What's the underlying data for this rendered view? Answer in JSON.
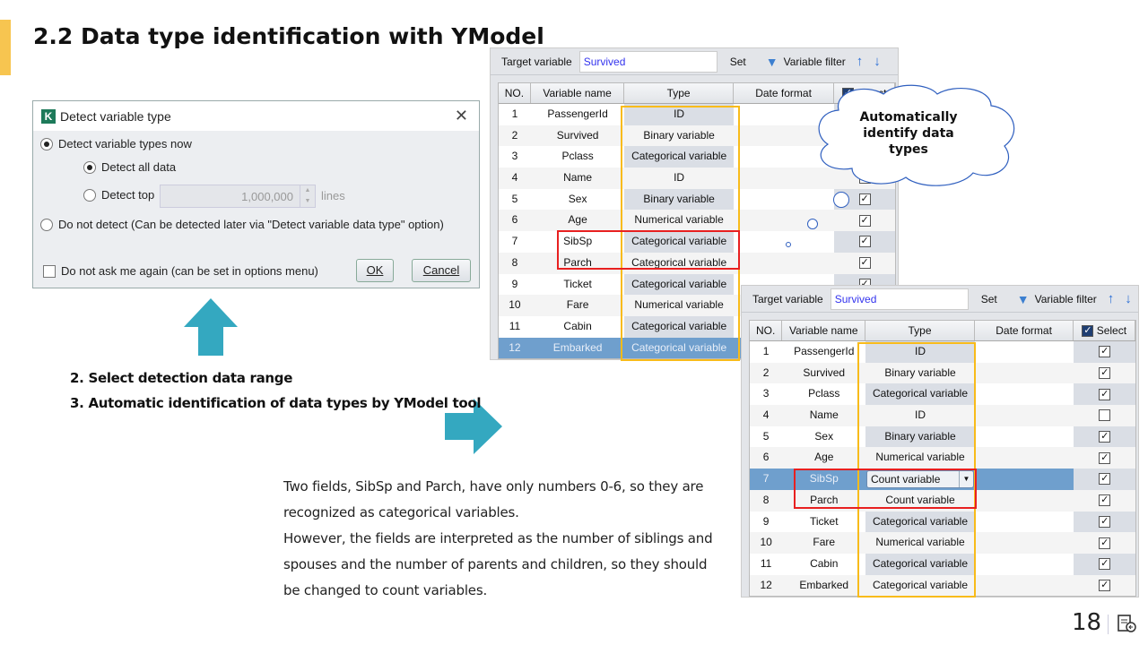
{
  "slide": {
    "title": "2.2 Data type identification with YModel",
    "page_number": "18",
    "steps": [
      "2. Select detection data range",
      "3. Automatic identification of data types by YModel tool"
    ],
    "paragraph": [
      "Two fields, SibSp and Parch, have only numbers 0-6, so they are recognized as categorical variables.",
      "However, the fields are interpreted as the number of siblings and spouses and the number of parents and children, so they should be changed to count variables."
    ],
    "callout": "Automatically identify data types",
    "colors": {
      "accent": "#f7c550",
      "arrow": "#34a8c0",
      "highlight_box": "#e82020",
      "type_box": "#f8bb1a"
    }
  },
  "dialog": {
    "title": "Detect variable type",
    "logo": "K",
    "opt_now": "Detect variable types now",
    "opt_all": "Detect all data",
    "opt_top": "Detect top",
    "top_value": "1,000,000",
    "lines": "lines",
    "opt_no": "Do not detect (Can be detected later via \"Detect variable data type\" option)",
    "dont_ask": "Do not ask me again (can be set in options menu)",
    "ok": "OK",
    "cancel": "Cancel"
  },
  "toolbar": {
    "target_label": "Target variable",
    "target_value": "Survived",
    "set": "Set",
    "filter": "Variable filter"
  },
  "columns": {
    "no": "NO.",
    "name": "Variable name",
    "type": "Type",
    "date": "Date format",
    "select": "Select"
  },
  "table_before": [
    {
      "no": "1",
      "name": "PassengerId",
      "type": "ID",
      "sel": true
    },
    {
      "no": "2",
      "name": "Survived",
      "type": "Binary variable",
      "sel": true
    },
    {
      "no": "3",
      "name": "Pclass",
      "type": "Categorical variable",
      "sel": true
    },
    {
      "no": "4",
      "name": "Name",
      "type": "ID",
      "sel": false
    },
    {
      "no": "5",
      "name": "Sex",
      "type": "Binary variable",
      "sel": true
    },
    {
      "no": "6",
      "name": "Age",
      "type": "Numerical variable",
      "sel": true
    },
    {
      "no": "7",
      "name": "SibSp",
      "type": "Categorical variable",
      "sel": true
    },
    {
      "no": "8",
      "name": "Parch",
      "type": "Categorical variable",
      "sel": true
    },
    {
      "no": "9",
      "name": "Ticket",
      "type": "Categorical variable",
      "sel": true
    },
    {
      "no": "10",
      "name": "Fare",
      "type": "Numerical variable",
      "sel": true
    },
    {
      "no": "11",
      "name": "Cabin",
      "type": "Categorical variable",
      "sel": true
    },
    {
      "no": "12",
      "name": "Embarked",
      "type": "Categorical variable",
      "sel": true,
      "selected": true
    }
  ],
  "table_after": [
    {
      "no": "1",
      "name": "PassengerId",
      "type": "ID",
      "sel": true
    },
    {
      "no": "2",
      "name": "Survived",
      "type": "Binary variable",
      "sel": true
    },
    {
      "no": "3",
      "name": "Pclass",
      "type": "Categorical variable",
      "sel": true
    },
    {
      "no": "4",
      "name": "Name",
      "type": "ID",
      "sel": false
    },
    {
      "no": "5",
      "name": "Sex",
      "type": "Binary variable",
      "sel": true
    },
    {
      "no": "6",
      "name": "Age",
      "type": "Numerical variable",
      "sel": true
    },
    {
      "no": "7",
      "name": "SibSp",
      "type": "Count variable",
      "sel": true,
      "selected": true,
      "combo": true
    },
    {
      "no": "8",
      "name": "Parch",
      "type": "Count variable",
      "sel": true
    },
    {
      "no": "9",
      "name": "Ticket",
      "type": "Categorical variable",
      "sel": true
    },
    {
      "no": "10",
      "name": "Fare",
      "type": "Numerical variable",
      "sel": true
    },
    {
      "no": "11",
      "name": "Cabin",
      "type": "Categorical variable",
      "sel": true
    },
    {
      "no": "12",
      "name": "Embarked",
      "type": "Categorical variable",
      "sel": true
    }
  ]
}
